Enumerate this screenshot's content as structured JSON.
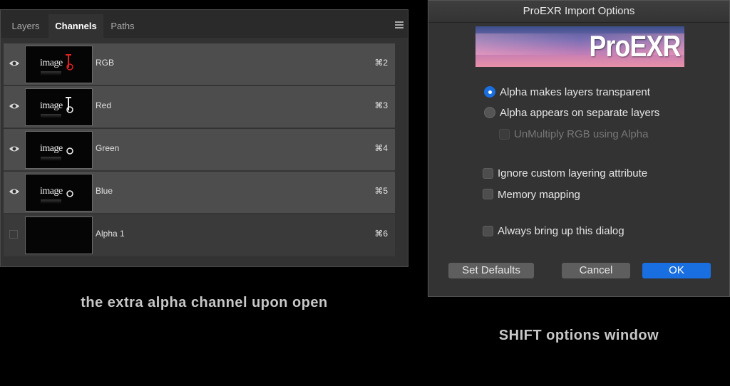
{
  "channels_panel": {
    "tabs": [
      "Layers",
      "Channels",
      "Paths"
    ],
    "active_tab": "Channels",
    "channels": [
      {
        "name": "RGB",
        "shortcut": "⌘2",
        "visible": true,
        "thumb_text": "image"
      },
      {
        "name": "Red",
        "shortcut": "⌘3",
        "visible": true,
        "thumb_text": "image"
      },
      {
        "name": "Green",
        "shortcut": "⌘4",
        "visible": true,
        "thumb_text": "image"
      },
      {
        "name": "Blue",
        "shortcut": "⌘5",
        "visible": true,
        "thumb_text": "image"
      },
      {
        "name": "Alpha 1",
        "shortcut": "⌘6",
        "visible": false,
        "thumb_text": ""
      }
    ],
    "caption": "the extra alpha channel upon open"
  },
  "dialog": {
    "title": "ProEXR Import Options",
    "banner_text": "ProEXR",
    "options": {
      "alpha_transparent": {
        "label": "Alpha makes layers transparent",
        "checked": true
      },
      "alpha_separate": {
        "label": "Alpha appears on separate layers",
        "checked": false
      },
      "unmultiply": {
        "label": "UnMultiply RGB using Alpha",
        "checked": false,
        "enabled": false
      },
      "ignore_layering": {
        "label": "Ignore custom layering attribute",
        "checked": false
      },
      "memory_mapping": {
        "label": "Memory mapping",
        "checked": false
      },
      "always_dialog": {
        "label": "Always bring up this dialog",
        "checked": false
      }
    },
    "buttons": {
      "set_defaults": "Set Defaults",
      "cancel": "Cancel",
      "ok": "OK"
    },
    "caption": "SHIFT options window",
    "accent_color": "#1a6fe0"
  }
}
